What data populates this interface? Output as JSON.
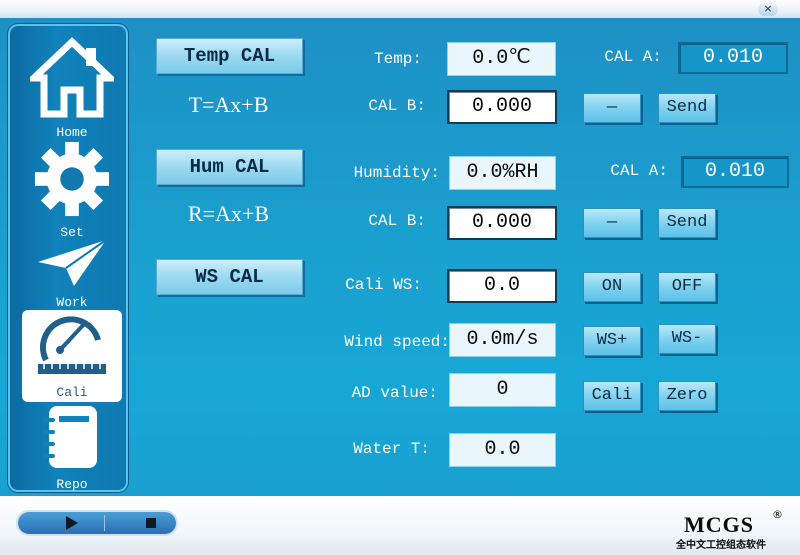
{
  "window": {
    "close_label": "×"
  },
  "sidebar": {
    "items": [
      {
        "label": "Home",
        "icon": "home-icon"
      },
      {
        "label": "Set",
        "icon": "gear-icon"
      },
      {
        "label": "Work",
        "icon": "paper-plane-icon"
      },
      {
        "label": "Cali",
        "icon": "protractor-ruler-icon"
      },
      {
        "label": "Repo",
        "icon": "notebook-icon"
      }
    ],
    "active": "Cali"
  },
  "calibration": {
    "temp_button": "Temp CAL",
    "temp_formula": "T=Ax+B",
    "hum_button": "Hum CAL",
    "hum_formula": "R=Ax+B",
    "ws_button": "WS CAL"
  },
  "temp": {
    "label": "Temp:",
    "value": "0.0℃",
    "cal_a_label": "CAL A:",
    "cal_a_value": "0.010",
    "cal_b_label": "CAL B:",
    "cal_b_value": "0.000",
    "minus_label": "—",
    "send_label": "Send"
  },
  "humidity": {
    "label": "Humidity:",
    "value": "0.0%RH",
    "cal_a_label": "CAL A:",
    "cal_a_value": "0.010",
    "cal_b_label": "CAL B:",
    "cal_b_value": "0.000",
    "minus_label": "—",
    "send_label": "Send"
  },
  "wind": {
    "cali_ws_label": "Cali WS:",
    "cali_ws_value": "0.0",
    "on_label": "ON",
    "off_label": "OFF",
    "wind_speed_label": "Wind speed:",
    "wind_speed_value": "0.0m/s",
    "ws_plus_label": "WS+",
    "ws_minus_label": "WS-",
    "ad_label": "AD value:",
    "ad_value": "0",
    "cali_label": "Cali",
    "zero_label": "Zero",
    "water_label": "Water T:",
    "water_value": "0.0"
  },
  "footer": {
    "brand": "MCGS",
    "registered": "®",
    "subtitle": "全中文工控组态软件"
  }
}
